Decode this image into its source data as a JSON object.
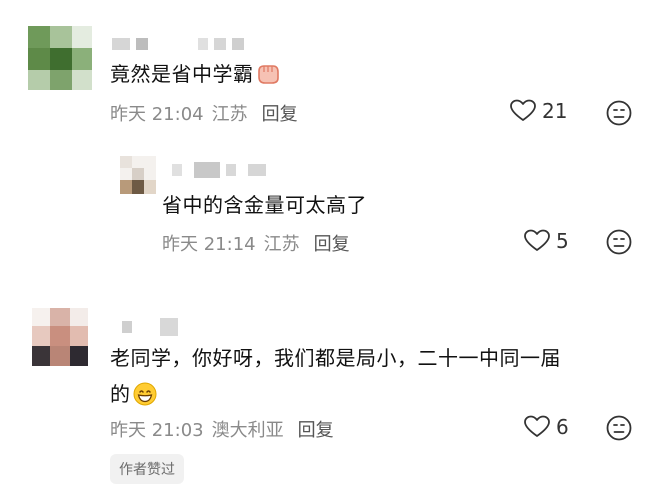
{
  "comments": [
    {
      "text": "竟然是省中学霸",
      "emoji": "fist-emoji",
      "time": "昨天 21:04",
      "location": "江苏",
      "reply_label": "回复",
      "likes": "21"
    },
    {
      "text": "省中的含金量可太高了",
      "time": "昨天 21:14",
      "location": "江苏",
      "reply_label": "回复",
      "likes": "5"
    },
    {
      "text_line1": "老同学，你好呀，我们都是局小，二十一中同一届",
      "text_line2": "的",
      "emoji": "grinning-emoji",
      "time": "昨天 21:03",
      "location": "澳大利亚",
      "reply_label": "回复",
      "likes": "6",
      "badge": "作者赞过"
    }
  ],
  "colors": {
    "text": "#111111",
    "meta": "#8a8a8a",
    "badge_bg": "#f1f1f1"
  }
}
